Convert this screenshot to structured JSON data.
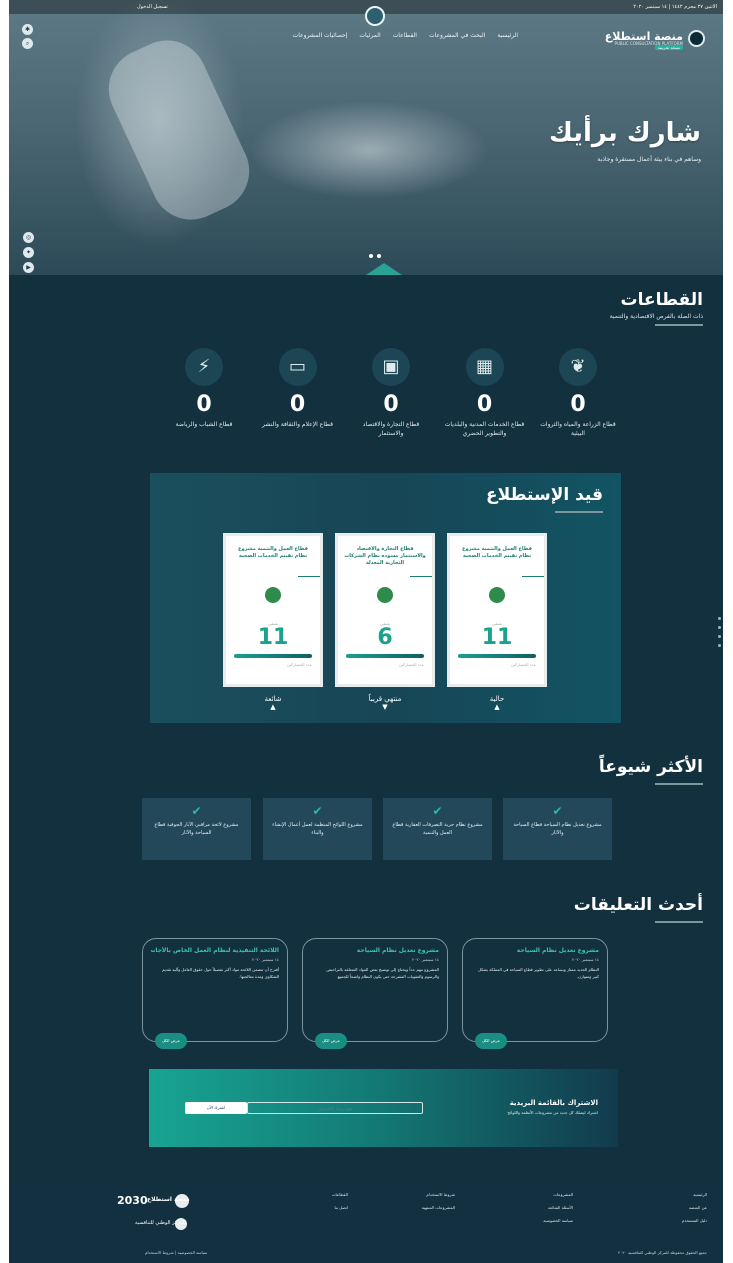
{
  "topbar": {
    "date": "الاثنين ٢٧ محرم ١٤٤٢ | ١٤ سبتمبر ٢٠٢٠",
    "login": "تسجيل الدخول"
  },
  "brand": {
    "name": "منصة استطلاع",
    "subtitle": "PUBLIC CONSULTATION PLATFORM",
    "tag": "نسخة تجريبية"
  },
  "menu": [
    "الرئيسية",
    "البحث في المشروعات",
    "القطاعات",
    "المرئيات",
    "إحصائيات المشروعات"
  ],
  "hero": {
    "title": "شارك برأيك",
    "subtitle": "وساهم في بناء بيئة أعمال مستقرة وجاذبة"
  },
  "sectors": {
    "title": "القطاعات",
    "subtitle": "ذات الصلة بالفرص الاقتصادية والتنمية",
    "items": [
      {
        "label": "قطاع الشباب والرياضة",
        "count": "0",
        "icon": "runner-icon",
        "glyph": "⚡"
      },
      {
        "label": "قطاع الإعلام والثقافة والنشر",
        "count": "0",
        "icon": "monitor-icon",
        "glyph": "▭"
      },
      {
        "label": "قطاع التجارة والاقتصاد والاستثمار",
        "count": "0",
        "icon": "wallet-icon",
        "glyph": "▣"
      },
      {
        "label": "قطاع الخدمات المدنية والبلديات والتطوير الحضري",
        "count": "0",
        "icon": "building-icon",
        "glyph": "▦"
      },
      {
        "label": "قطاع الزراعة والمياه والثروات البيئية",
        "count": "0",
        "icon": "leaf-icon",
        "glyph": "❦"
      }
    ]
  },
  "polls": {
    "title": "قيد الإستطلاع",
    "remaining_label": "متبقي",
    "days_label": "يوم",
    "footer_label": "عدد المشاركين",
    "cards": [
      {
        "title": "قطاع العمل والتنمية مشروع نظام تقييم الخدمات الصحية",
        "days": "11",
        "status": "حالية",
        "arrow": "up"
      },
      {
        "title": "قطاع التجارة والاقتصاد والاستثمار مسودة نظام الشركات التجارية المعدلة",
        "days": "6",
        "status": "منتهي قريباً",
        "arrow": "down"
      },
      {
        "title": "قطاع العمل والتنمية مشروع نظام تقييم الخدمات الصحية",
        "days": "11",
        "status": "شائعة",
        "arrow": "up"
      }
    ]
  },
  "popular": {
    "title": "الأكثر شيوعاً",
    "items": [
      {
        "text": "مشروع تعديل نظام السياحة قطاع السياحة والآثار"
      },
      {
        "text": "مشروع نظام حرية التصرفات العقارية قطاع العمل والتنمية"
      },
      {
        "text": "مشروع اللوائح المنظمة لعمل أعمال الإنشاء والبناء"
      },
      {
        "text": "مشروع لائحة مراقبي الآبار الجوفية قطاع السياحة والآثار"
      }
    ]
  },
  "comments": {
    "title": "أحدث التعليقات",
    "read_more": "عرض الكل",
    "items": [
      {
        "title": "مشروع تعديل نظام السياحة",
        "date": "١٤ سبتمبر ٢٠٢٠",
        "body": "النظام الجديد ممتاز ويساعد على تطوير قطاع السياحة في المملكة بشكل كبير ومتوازن."
      },
      {
        "title": "مشروع تعديل نظام السياحة",
        "date": "١٤ سبتمبر ٢٠٢٠",
        "body": "المشروع مهم جداً ويحتاج إلى توضيح بعض المواد المتعلقة بالتراخيص والرسوم والعقوبات المقترحة حتى يكون النظام واضحاً للجميع."
      },
      {
        "title": "اللائحة التنفيذية لنظام العمل الخاص بالأجانب",
        "date": "١٤ سبتمبر ٢٠٢٠",
        "body": "أقترح أن تتضمن اللائحة مواد أكثر تفصيلاً حول حقوق العامل وآلية تقديم الشكاوى ومدة معالجتها."
      }
    ]
  },
  "newsletter": {
    "title": "الاشتراك بالقائمة البريدية",
    "subtitle": "اشترك ليصلك كل جديد من مشروعات الأنظمة واللوائح",
    "placeholder": "ضع بريدك الإلكتروني",
    "button": "اشترك الآن"
  },
  "footer": {
    "columns": [
      [
        "الرئيسية",
        "عن المنصة",
        "دليل المستخدم"
      ],
      [
        "المشروعات",
        "الأسئلة الشائعة",
        "سياسة الخصوصية"
      ],
      [
        "شروط الاستخدام",
        "المشروعات المنتهية"
      ],
      [
        "القطاعات",
        "اتصل بنا"
      ]
    ],
    "vision": "2030",
    "logo_text": "منصة استطلاع",
    "center_text": "المركز الوطني للتنافسية",
    "copyright": "جميع الحقوق محفوظة للمركز الوطني للتنافسية ٢٠٢٠",
    "links": "سياسة الخصوصية | شروط الاستخدام"
  },
  "colors": {
    "page_bg": "#13303f",
    "accent": "#1aa18f",
    "card_bg": "#22485a"
  }
}
